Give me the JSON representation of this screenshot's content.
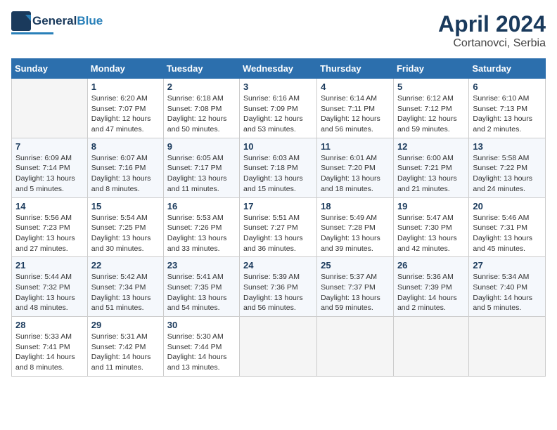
{
  "header": {
    "logo_general": "General",
    "logo_blue": "Blue",
    "title": "April 2024",
    "subtitle": "Cortanovci, Serbia"
  },
  "columns": [
    "Sunday",
    "Monday",
    "Tuesday",
    "Wednesday",
    "Thursday",
    "Friday",
    "Saturday"
  ],
  "weeks": [
    [
      {
        "day": "",
        "info": ""
      },
      {
        "day": "1",
        "info": "Sunrise: 6:20 AM\nSunset: 7:07 PM\nDaylight: 12 hours\nand 47 minutes."
      },
      {
        "day": "2",
        "info": "Sunrise: 6:18 AM\nSunset: 7:08 PM\nDaylight: 12 hours\nand 50 minutes."
      },
      {
        "day": "3",
        "info": "Sunrise: 6:16 AM\nSunset: 7:09 PM\nDaylight: 12 hours\nand 53 minutes."
      },
      {
        "day": "4",
        "info": "Sunrise: 6:14 AM\nSunset: 7:11 PM\nDaylight: 12 hours\nand 56 minutes."
      },
      {
        "day": "5",
        "info": "Sunrise: 6:12 AM\nSunset: 7:12 PM\nDaylight: 12 hours\nand 59 minutes."
      },
      {
        "day": "6",
        "info": "Sunrise: 6:10 AM\nSunset: 7:13 PM\nDaylight: 13 hours\nand 2 minutes."
      }
    ],
    [
      {
        "day": "7",
        "info": "Sunrise: 6:09 AM\nSunset: 7:14 PM\nDaylight: 13 hours\nand 5 minutes."
      },
      {
        "day": "8",
        "info": "Sunrise: 6:07 AM\nSunset: 7:16 PM\nDaylight: 13 hours\nand 8 minutes."
      },
      {
        "day": "9",
        "info": "Sunrise: 6:05 AM\nSunset: 7:17 PM\nDaylight: 13 hours\nand 11 minutes."
      },
      {
        "day": "10",
        "info": "Sunrise: 6:03 AM\nSunset: 7:18 PM\nDaylight: 13 hours\nand 15 minutes."
      },
      {
        "day": "11",
        "info": "Sunrise: 6:01 AM\nSunset: 7:20 PM\nDaylight: 13 hours\nand 18 minutes."
      },
      {
        "day": "12",
        "info": "Sunrise: 6:00 AM\nSunset: 7:21 PM\nDaylight: 13 hours\nand 21 minutes."
      },
      {
        "day": "13",
        "info": "Sunrise: 5:58 AM\nSunset: 7:22 PM\nDaylight: 13 hours\nand 24 minutes."
      }
    ],
    [
      {
        "day": "14",
        "info": "Sunrise: 5:56 AM\nSunset: 7:23 PM\nDaylight: 13 hours\nand 27 minutes."
      },
      {
        "day": "15",
        "info": "Sunrise: 5:54 AM\nSunset: 7:25 PM\nDaylight: 13 hours\nand 30 minutes."
      },
      {
        "day": "16",
        "info": "Sunrise: 5:53 AM\nSunset: 7:26 PM\nDaylight: 13 hours\nand 33 minutes."
      },
      {
        "day": "17",
        "info": "Sunrise: 5:51 AM\nSunset: 7:27 PM\nDaylight: 13 hours\nand 36 minutes."
      },
      {
        "day": "18",
        "info": "Sunrise: 5:49 AM\nSunset: 7:28 PM\nDaylight: 13 hours\nand 39 minutes."
      },
      {
        "day": "19",
        "info": "Sunrise: 5:47 AM\nSunset: 7:30 PM\nDaylight: 13 hours\nand 42 minutes."
      },
      {
        "day": "20",
        "info": "Sunrise: 5:46 AM\nSunset: 7:31 PM\nDaylight: 13 hours\nand 45 minutes."
      }
    ],
    [
      {
        "day": "21",
        "info": "Sunrise: 5:44 AM\nSunset: 7:32 PM\nDaylight: 13 hours\nand 48 minutes."
      },
      {
        "day": "22",
        "info": "Sunrise: 5:42 AM\nSunset: 7:34 PM\nDaylight: 13 hours\nand 51 minutes."
      },
      {
        "day": "23",
        "info": "Sunrise: 5:41 AM\nSunset: 7:35 PM\nDaylight: 13 hours\nand 54 minutes."
      },
      {
        "day": "24",
        "info": "Sunrise: 5:39 AM\nSunset: 7:36 PM\nDaylight: 13 hours\nand 56 minutes."
      },
      {
        "day": "25",
        "info": "Sunrise: 5:37 AM\nSunset: 7:37 PM\nDaylight: 13 hours\nand 59 minutes."
      },
      {
        "day": "26",
        "info": "Sunrise: 5:36 AM\nSunset: 7:39 PM\nDaylight: 14 hours\nand 2 minutes."
      },
      {
        "day": "27",
        "info": "Sunrise: 5:34 AM\nSunset: 7:40 PM\nDaylight: 14 hours\nand 5 minutes."
      }
    ],
    [
      {
        "day": "28",
        "info": "Sunrise: 5:33 AM\nSunset: 7:41 PM\nDaylight: 14 hours\nand 8 minutes."
      },
      {
        "day": "29",
        "info": "Sunrise: 5:31 AM\nSunset: 7:42 PM\nDaylight: 14 hours\nand 11 minutes."
      },
      {
        "day": "30",
        "info": "Sunrise: 5:30 AM\nSunset: 7:44 PM\nDaylight: 14 hours\nand 13 minutes."
      },
      {
        "day": "",
        "info": ""
      },
      {
        "day": "",
        "info": ""
      },
      {
        "day": "",
        "info": ""
      },
      {
        "day": "",
        "info": ""
      }
    ]
  ]
}
